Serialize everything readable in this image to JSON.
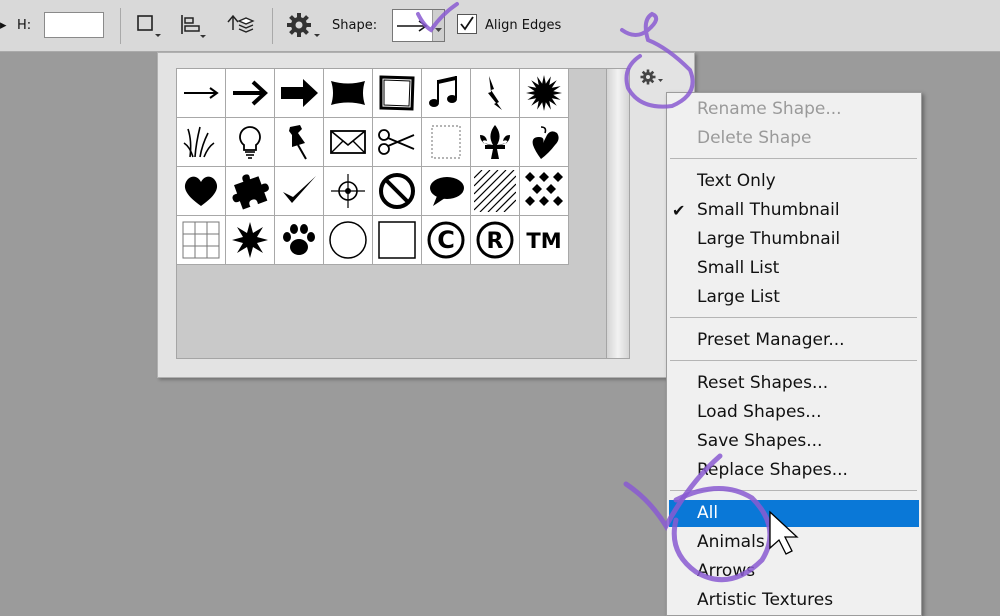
{
  "toolbar": {
    "h_label": "H:",
    "h_value": "",
    "shape_label": "Shape:",
    "align_edges_label": "Align Edges",
    "align_edges_checked": true
  },
  "panel": {
    "shapes": [
      "thin-arrow",
      "arrow",
      "bold-arrow",
      "banner",
      "frame",
      "music-notes",
      "lightning",
      "starburst",
      "grass",
      "lightbulb",
      "pushpin",
      "envelope",
      "scissors",
      "stamp",
      "fleur-de-lis",
      "ornament",
      "heart",
      "puzzle-piece",
      "checkmark",
      "target",
      "no-symbol",
      "speech-bubble",
      "diagonal-lines",
      "diamond-grid",
      "grid",
      "spiky-star",
      "paw-print",
      "circle",
      "square",
      "copyright",
      "registered",
      "trademark"
    ]
  },
  "menu": {
    "items": [
      {
        "label": "Rename Shape...",
        "disabled": true
      },
      {
        "label": "Delete Shape",
        "disabled": true
      },
      {
        "label": "Text Only"
      },
      {
        "label": "Small Thumbnail",
        "checked": true
      },
      {
        "label": "Large Thumbnail"
      },
      {
        "label": "Small List"
      },
      {
        "label": "Large List"
      },
      {
        "label": "Preset Manager..."
      },
      {
        "label": "Reset Shapes..."
      },
      {
        "label": "Load Shapes..."
      },
      {
        "label": "Save Shapes..."
      },
      {
        "label": "Replace Shapes..."
      },
      {
        "label": "All",
        "selected": true
      },
      {
        "label": "Animals"
      },
      {
        "label": "Arrows"
      },
      {
        "label": "Artistic Textures"
      }
    ],
    "check_glyph": "✔"
  },
  "colors": {
    "highlight": "#0a78d7",
    "annotation": "#8a5bd1"
  }
}
